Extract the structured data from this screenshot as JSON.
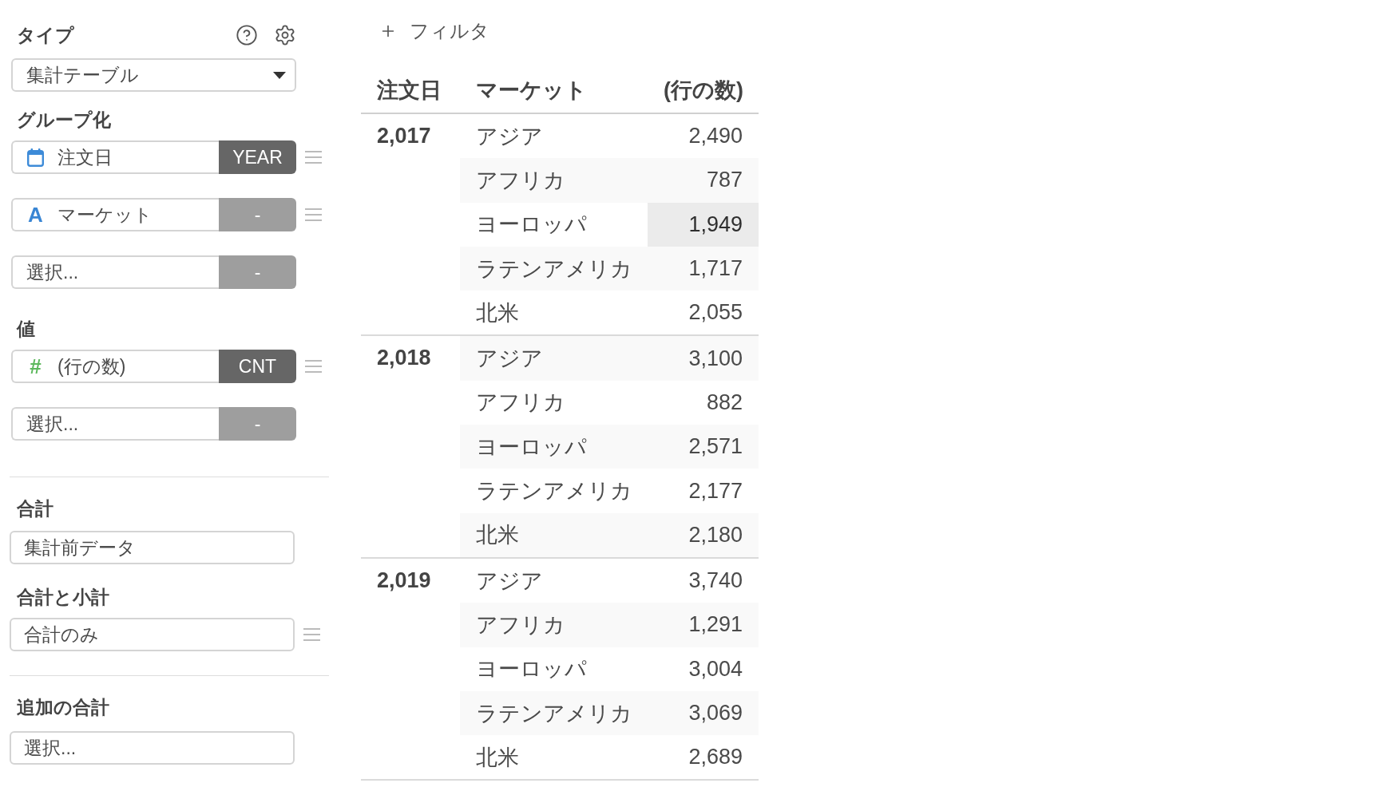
{
  "settings_panel": {
    "type": {
      "label": "タイプ",
      "dropdown": {
        "value": "集計テーブル"
      }
    },
    "grouping": {
      "label": "グループ化",
      "fields": [
        {
          "kind": "date",
          "name": "注文日",
          "function": "YEAR",
          "function_set": true
        },
        {
          "kind": "text",
          "icon": "A",
          "name": "マーケット",
          "function": "-",
          "function_set": false
        },
        {
          "kind": "empty",
          "placeholder": "選択...",
          "function": "-",
          "function_set": false
        }
      ]
    },
    "values": {
      "label": "値",
      "fields": [
        {
          "kind": "number",
          "icon": "#",
          "name": "(行の数)",
          "function": "CNT",
          "function_set": true
        },
        {
          "kind": "empty",
          "placeholder": "選択...",
          "function": "-",
          "function_set": false
        }
      ]
    },
    "totals": {
      "sections": [
        {
          "label": "合計",
          "value": "集計前データ",
          "draggable": false
        },
        {
          "label": "合計と小計",
          "value": "合計のみ",
          "draggable": true
        }
      ]
    },
    "additional_totals": {
      "label": "追加の合計",
      "placeholder": "選択..."
    }
  },
  "filter_button": {
    "label": "フィルタ"
  },
  "table": {
    "columns": [
      "注文日",
      "マーケット",
      "(行の数)"
    ],
    "groups": [
      {
        "year": "2,017",
        "rows": [
          {
            "market": "アジア",
            "count": "2,490",
            "selected": false
          },
          {
            "market": "アフリカ",
            "count": "787",
            "selected": false
          },
          {
            "market": "ヨーロッパ",
            "count": "1,949",
            "selected": true
          },
          {
            "market": "ラテンアメリカ",
            "count": "1,717",
            "selected": false
          },
          {
            "market": "北米",
            "count": "2,055",
            "selected": false
          }
        ]
      },
      {
        "year": "2,018",
        "rows": [
          {
            "market": "アジア",
            "count": "3,100",
            "selected": false
          },
          {
            "market": "アフリカ",
            "count": "882",
            "selected": false
          },
          {
            "market": "ヨーロッパ",
            "count": "2,571",
            "selected": false
          },
          {
            "market": "ラテンアメリカ",
            "count": "2,177",
            "selected": false
          },
          {
            "market": "北米",
            "count": "2,180",
            "selected": false
          }
        ]
      },
      {
        "year": "2,019",
        "rows": [
          {
            "market": "アジア",
            "count": "3,740",
            "selected": false
          },
          {
            "market": "アフリカ",
            "count": "1,291",
            "selected": false
          },
          {
            "market": "ヨーロッパ",
            "count": "3,004",
            "selected": false
          },
          {
            "market": "ラテンアメリカ",
            "count": "3,069",
            "selected": false
          },
          {
            "market": "北米",
            "count": "2,689",
            "selected": false
          }
        ]
      }
    ]
  }
}
